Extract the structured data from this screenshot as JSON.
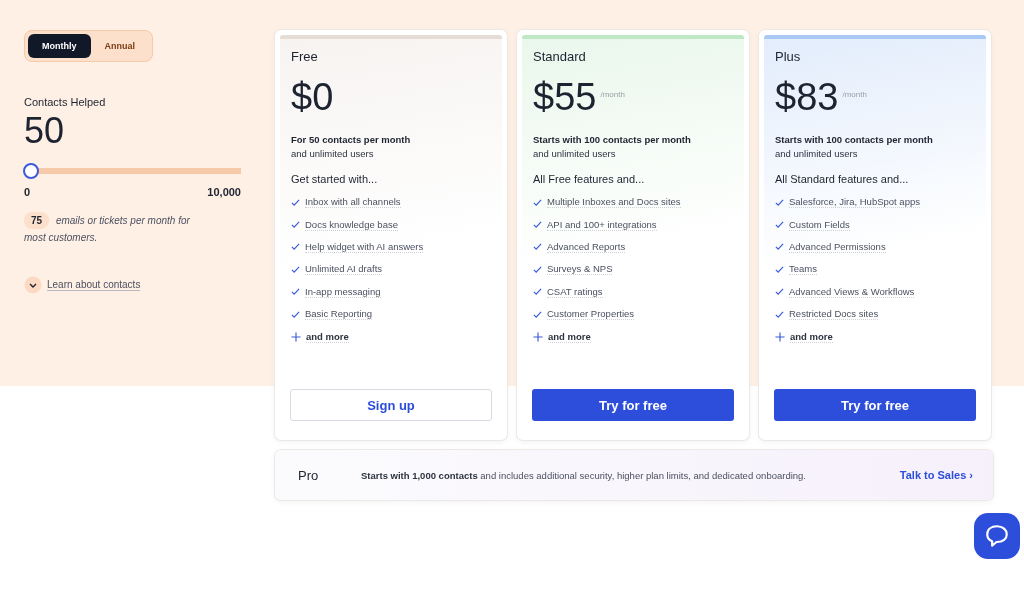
{
  "billing_toggle": [
    {
      "label": "Monthly",
      "selected": true
    },
    {
      "label": "Annual",
      "selected": false
    }
  ],
  "contacts": {
    "label": "Contacts Helped",
    "value": "50",
    "slider": {
      "level": 0.005,
      "min": "0",
      "max": "10,000"
    },
    "emails_count": "75",
    "emails_text": "emails or tickets per month for most customers.",
    "learn_link": "Learn about contacts"
  },
  "plans": [
    {
      "name": "Free",
      "price": "$0",
      "color": "#e6dcd6",
      "summary": "For 50 contacts per month",
      "summary_sub": "and unlimited users",
      "features_heading": "Get started with...",
      "features": [
        "Inbox with all channels",
        "Docs knowledge base",
        "Help widget with AI answers",
        "Unlimited AI drafts",
        "In-app messaging",
        "Basic Reporting"
      ],
      "more": "and more",
      "button": {
        "label": "Sign up",
        "kind": "outline"
      }
    },
    {
      "name": "Standard",
      "price": "$55",
      "period": "/month",
      "color": "#bfe8c4",
      "summary": "Starts with 100 contacts per month",
      "summary_sub": "and unlimited users",
      "features_heading": "All Free features and...",
      "features": [
        "Multiple Inboxes and Docs sites",
        "API and 100+ integrations",
        "Advanced Reports",
        "Surveys & NPS",
        "CSAT ratings",
        "Customer Properties"
      ],
      "more": "and more",
      "button": {
        "label": "Try for free",
        "kind": "filled"
      }
    },
    {
      "name": "Plus",
      "price": "$83",
      "period": "/month",
      "color": "#a9c8f5",
      "summary": "Starts with 100 contacts per month",
      "summary_sub": "and unlimited users",
      "features_heading": "All Standard features and...",
      "features": [
        "Salesforce, Jira, HubSpot apps",
        "Custom Fields",
        "Advanced Permissions",
        "Teams",
        "Advanced Views & Workflows",
        "Restricted Docs sites"
      ],
      "more": "and more",
      "button": {
        "label": "Try for free",
        "kind": "filled"
      }
    }
  ],
  "pro": {
    "name": "Pro",
    "text": "**Starts with 1,000 contacts** and includes additional security, higher plan limits, and dedicated onboarding.",
    "link": "Talk to Sales ›"
  }
}
